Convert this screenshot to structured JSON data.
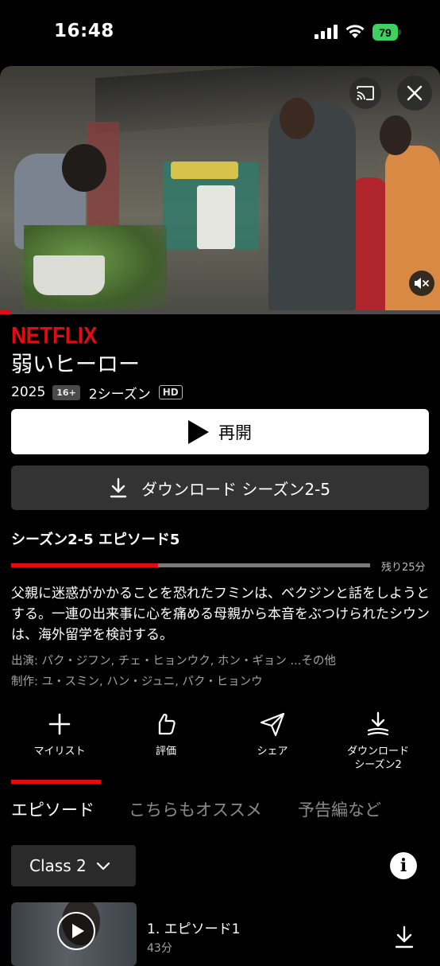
{
  "status_bar": {
    "time": "16:48",
    "battery": "79"
  },
  "show": {
    "brand": "NETFLIX",
    "title": "弱いヒーロー",
    "year": "2025",
    "age_rating": "16+",
    "seasons": "2シーズン",
    "quality": "HD"
  },
  "video": {
    "progress": 0.025
  },
  "buttons": {
    "resume": "再開",
    "download": "ダウンロード シーズン2-5"
  },
  "episode": {
    "heading": "シーズン2-5 エピソード5",
    "progress": 0.41,
    "remaining": "残り25分",
    "synopsis": "父親に迷惑がかかることを恐れたフミンは、ベクジンと話をしようとする。一連の出来事に心を痛める母親から本音をぶつけられたシウンは、海外留学を検討する。",
    "cast": "出演: パク・ジフン, チェ・ヒョンウク, ホン・ギョン ...その他",
    "creators": "制作: ユ・スミン, ハン・ジュニ, パク・ヒョンウ"
  },
  "actions": {
    "my_list": "マイリスト",
    "rate": "評価",
    "share": "シェア",
    "download_line1": "ダウンロード",
    "download_line2": "シーズン2"
  },
  "tabs": [
    "エピソード",
    "こちらもオススメ",
    "予告編など"
  ],
  "season_selector": "Class 2",
  "episodes": [
    {
      "title": "1. エピソード1",
      "duration": "43分"
    }
  ],
  "colors": {
    "accent": "#e50914",
    "background": "#000000"
  }
}
